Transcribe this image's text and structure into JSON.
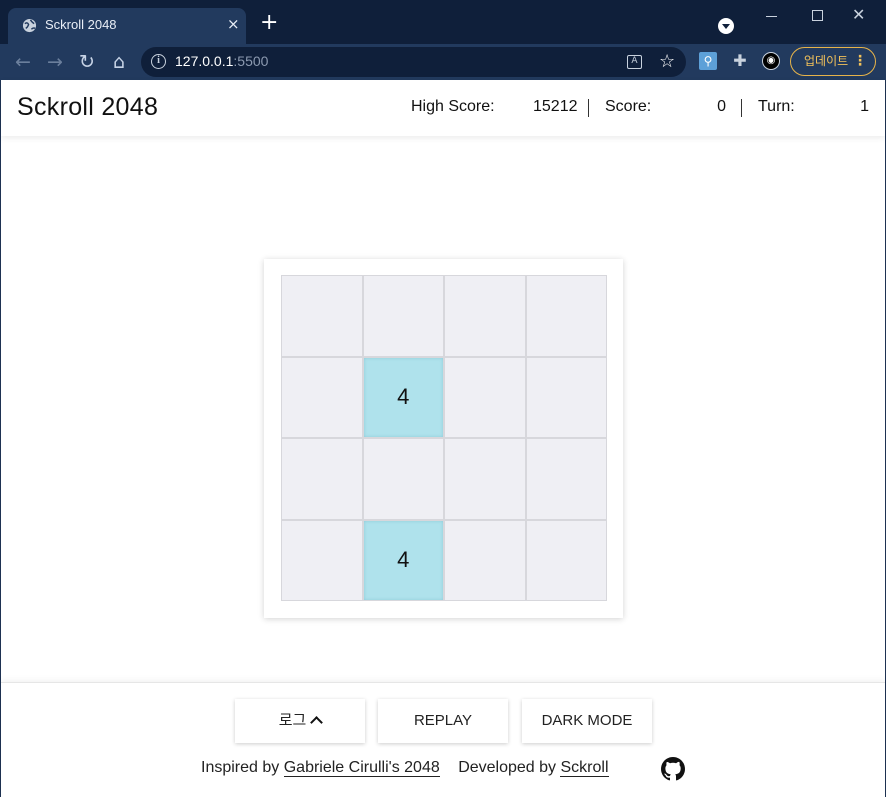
{
  "browser": {
    "tab_title": "Sckroll 2048",
    "tab_close": "×",
    "new_tab": "+",
    "url_host": "127.0.0.1",
    "url_port": ":5500",
    "update_label": "업데이트",
    "update_menu": "⋮",
    "win_close": "✕"
  },
  "header": {
    "title": "Sckroll 2048",
    "high_score_label": "High Score:",
    "high_score": "15212",
    "score_label": "Score:",
    "score": "0",
    "turn_label": "Turn:",
    "turn": "1"
  },
  "board": {
    "rows": [
      [
        "",
        "",
        "",
        ""
      ],
      [
        "",
        "4",
        "",
        ""
      ],
      [
        "",
        "",
        "",
        ""
      ],
      [
        "",
        "4",
        "",
        ""
      ]
    ]
  },
  "footer": {
    "log_label": "로그",
    "replay_label": "REPLAY",
    "dark_mode_label": "DARK MODE",
    "inspired_prefix": "Inspired by",
    "inspired_link": "Gabriele Cirulli's 2048",
    "developed_prefix": "Developed by",
    "developed_link": "Sckroll"
  },
  "colors": {
    "tile": "#afe2ec",
    "empty_cell": "#efeff4",
    "chrome_dark": "#0f1f3a",
    "chrome_toolbar": "#223a5e",
    "update_accent": "#e6b34a"
  }
}
